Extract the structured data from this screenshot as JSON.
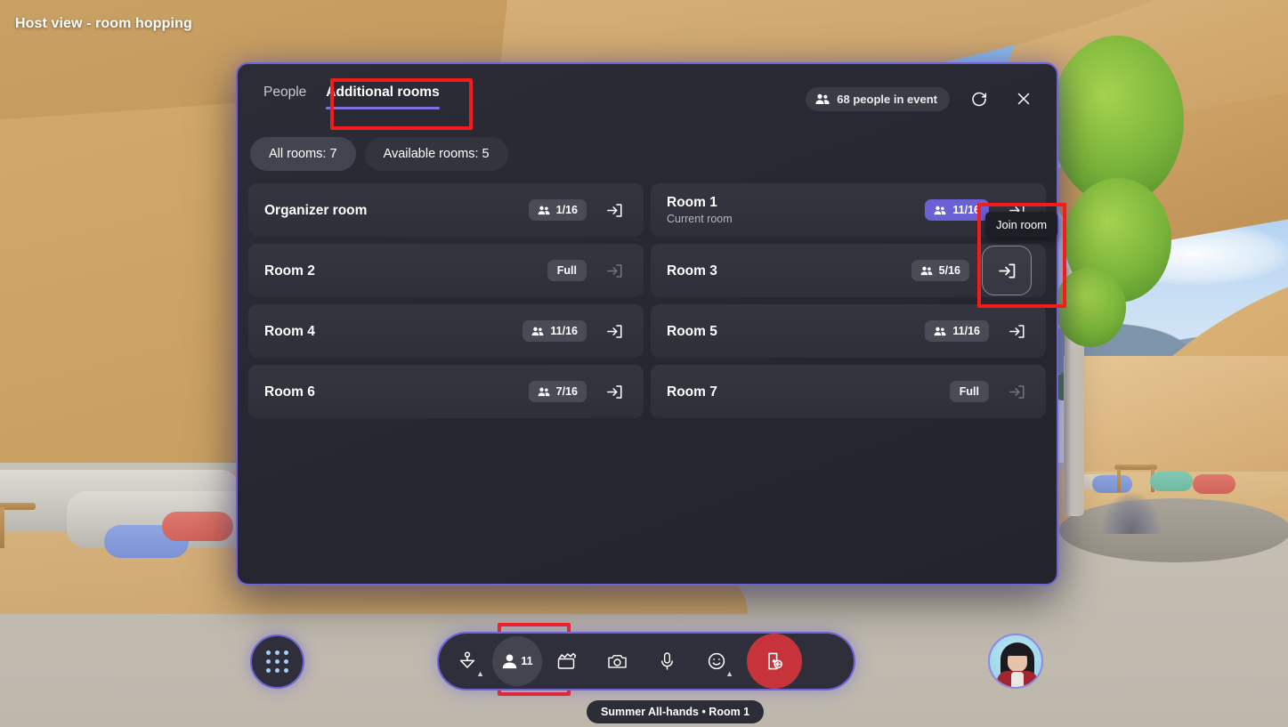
{
  "overlay": {
    "host_title": "Host view - room hopping"
  },
  "panel": {
    "tabs": [
      {
        "label": "People",
        "active": false
      },
      {
        "label": "Additional rooms",
        "active": true
      }
    ],
    "header": {
      "people_chip": "68 people in event",
      "people_chip_icon": "people-group-icon",
      "refresh_icon": "refresh-icon",
      "close_icon": "close-icon"
    },
    "filters": [
      {
        "label": "All rooms: 7",
        "selected": true
      },
      {
        "label": "Available rooms: 5",
        "selected": false
      }
    ],
    "rooms": [
      {
        "name": "Organizer room",
        "sub": "",
        "badge": "1/16",
        "badge_type": "normal",
        "join_state": "enabled"
      },
      {
        "name": "Room 1",
        "sub": "Current room",
        "badge": "11/16",
        "badge_type": "current",
        "join_state": "enabled"
      },
      {
        "name": "Room 2",
        "sub": "",
        "badge": "Full",
        "badge_type": "full",
        "join_state": "disabled"
      },
      {
        "name": "Room 3",
        "sub": "",
        "badge": "5/16",
        "badge_type": "normal",
        "join_state": "hovered"
      },
      {
        "name": "Room 4",
        "sub": "",
        "badge": "11/16",
        "badge_type": "normal",
        "join_state": "enabled"
      },
      {
        "name": "Room 5",
        "sub": "",
        "badge": "11/16",
        "badge_type": "normal",
        "join_state": "enabled"
      },
      {
        "name": "Room 6",
        "sub": "",
        "badge": "7/16",
        "badge_type": "normal",
        "join_state": "enabled"
      },
      {
        "name": "Room 7",
        "sub": "",
        "badge": "Full",
        "badge_type": "full",
        "join_state": "disabled"
      }
    ],
    "tooltip": "Join room"
  },
  "toolbar": {
    "apps_icon": "apps-grid-icon",
    "items": [
      {
        "icon": "raise-hand-icon",
        "label": "",
        "caret": true,
        "selected": false
      },
      {
        "icon": "people-icon",
        "label": "11",
        "caret": false,
        "selected": true
      },
      {
        "icon": "clapboard-icon",
        "label": "",
        "caret": false,
        "selected": false
      },
      {
        "icon": "camera-icon",
        "label": "",
        "caret": false,
        "selected": false
      },
      {
        "icon": "microphone-icon",
        "label": "",
        "caret": false,
        "selected": false
      },
      {
        "icon": "reactions-smiley-icon",
        "label": "",
        "caret": true,
        "selected": false
      },
      {
        "icon": "leave-room-icon",
        "label": "",
        "caret": false,
        "selected": false
      }
    ]
  },
  "status_bar": {
    "text": "Summer All-hands • Room 1"
  },
  "colors": {
    "accent_purple": "#6f63d8",
    "current_badge": "#6a61d4",
    "leave_red": "#c6333a",
    "annotation_red": "#f61b1b",
    "panel_bg": "#272832",
    "row_bg": "#31323c"
  }
}
